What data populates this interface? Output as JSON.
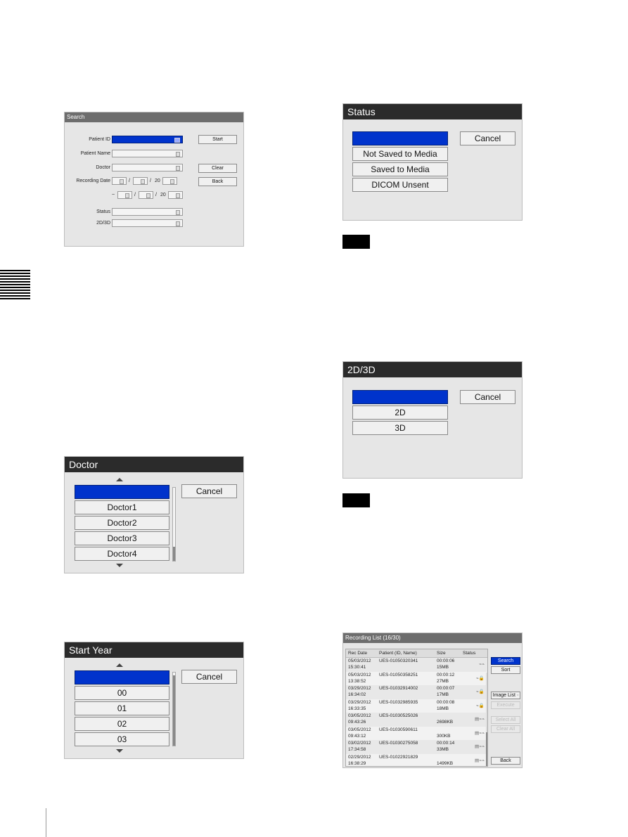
{
  "search_dialog": {
    "title": "Search",
    "labels": {
      "patient_id": "Patient ID",
      "patient_name": "Patient Name",
      "doctor": "Doctor",
      "recording_date": "Recording Date",
      "status": "Status",
      "dim": "2D/3D"
    },
    "date_separator": "/",
    "year_prefix": "20",
    "range_tilde": "~",
    "buttons": {
      "start": "Start",
      "clear": "Clear",
      "back": "Back"
    }
  },
  "status_dialog": {
    "title": "Status",
    "options": [
      "",
      "Not Saved to Media",
      "Saved to Media",
      "DICOM Unsent"
    ],
    "cancel": "Cancel"
  },
  "dim_dialog": {
    "title": "2D/3D",
    "options": [
      "",
      "2D",
      "3D"
    ],
    "cancel": "Cancel"
  },
  "doctor_dialog": {
    "title": "Doctor",
    "options": [
      "",
      "Doctor1",
      "Doctor2",
      "Doctor3",
      "Doctor4"
    ],
    "cancel": "Cancel"
  },
  "start_year_dialog": {
    "title": "Start Year",
    "options": [
      "",
      "00",
      "01",
      "02",
      "03"
    ],
    "cancel": "Cancel"
  },
  "recording_list": {
    "title": "Recording List  (16/30)",
    "columns": [
      "Rec Date",
      "Patient (ID, Name)",
      "Size",
      "Status"
    ],
    "rows": [
      {
        "date": "05/03/2012",
        "time": "15:30:41",
        "patient": "UES-01050320341",
        "duration": "00:00:06",
        "size": "15MB",
        "status": "network-icons"
      },
      {
        "date": "05/03/2012",
        "time": "13:38:52",
        "patient": "UES-01050358251",
        "duration": "00:00:12",
        "size": "27MB",
        "status": "network-lock-icons"
      },
      {
        "date": "03/29/2012",
        "time": "16:34:02",
        "patient": "UES-01032914002",
        "duration": "00:00:07",
        "size": "17MB",
        "status": "network-lock-icons"
      },
      {
        "date": "03/29/2012",
        "time": "16:33:35",
        "patient": "UES-01032985935",
        "duration": "00:00:08",
        "size": "18MB",
        "status": "network-lock-icons"
      },
      {
        "date": "03/05/2012",
        "time": "09:43:26",
        "patient": "UES-01030525026",
        "duration": "",
        "size": "2698KB",
        "status": "media-network-icons"
      },
      {
        "date": "03/05/2012",
        "time": "09:43:12",
        "patient": "UES-01030590611",
        "duration": "",
        "size": "300KB",
        "status": "media-network-icons"
      },
      {
        "date": "03/02/2012",
        "time": "17:34:58",
        "patient": "UES-01030275058",
        "duration": "00:00:14",
        "size": "33MB",
        "status": "media-network-icons"
      },
      {
        "date": "02/29/2012",
        "time": "16:38:29",
        "patient": "UES-01022921829",
        "duration": "",
        "size": "1499KB",
        "status": "media-network-icons"
      }
    ],
    "buttons": {
      "search": "Search",
      "sort": "Sort",
      "image_list": "Image List",
      "execute": "Execute",
      "select_all": "Select All",
      "clear_all": "Clear All",
      "back": "Back"
    }
  }
}
